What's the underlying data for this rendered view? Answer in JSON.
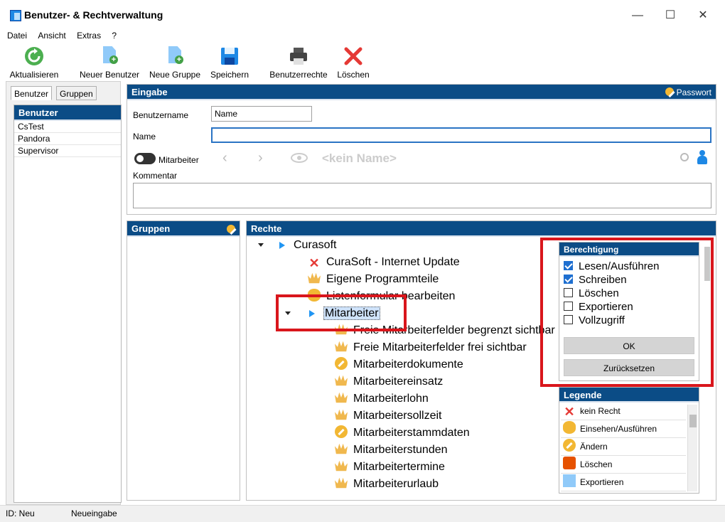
{
  "window": {
    "title": "Benutzer- &  Rechtverwaltung",
    "minimize": "—",
    "maximize": "☐",
    "close": "✕"
  },
  "menu": [
    "Datei",
    "Ansicht",
    "Extras",
    "?"
  ],
  "toolbar": {
    "refresh": "Aktualisieren",
    "new_user": "Neuer Benutzer",
    "new_group": "Neue Gruppe",
    "save": "Speichern",
    "user_rights": "Benutzerrechte",
    "delete": "Löschen"
  },
  "left": {
    "tabs": [
      "Benutzer",
      "Gruppen"
    ],
    "header": "Benutzer",
    "users": [
      "CsTest",
      "Pandora",
      "Supervisor"
    ]
  },
  "eingabe": {
    "header": "Eingabe",
    "password": "Passwort",
    "username_label": "Benutzername",
    "username_value": "Name",
    "name_label": "Name",
    "name_value": "",
    "employee_toggle": "Mitarbeiter",
    "no_name": "<kein Name>",
    "comment_label": "Kommentar"
  },
  "gruppen": {
    "header": "Gruppen"
  },
  "rechte": {
    "header": "Rechte",
    "tree": [
      {
        "label": "Curasoft",
        "icon": "expand-triangle-icon"
      },
      {
        "label": "CuraSoft - Internet Update",
        "icon": "no-right-icon"
      },
      {
        "label": "Eigene Programmteile",
        "icon": "crown-icon"
      },
      {
        "label": "Listenformular bearbeiten",
        "icon": "view-icon"
      },
      {
        "label": "Mitarbeiter",
        "icon": "expand-triangle-icon"
      },
      {
        "label": "Freie Mitarbeiterfelder begrenzt sichtbar",
        "icon": "crown-icon"
      },
      {
        "label": "Freie Mitarbeiterfelder frei sichtbar",
        "icon": "crown-icon"
      },
      {
        "label": "Mitarbeiterdokumente",
        "icon": "edit-icon"
      },
      {
        "label": "Mitarbeitereinsatz",
        "icon": "crown-icon"
      },
      {
        "label": "Mitarbeiterlohn",
        "icon": "crown-icon"
      },
      {
        "label": "Mitarbeitersollzeit",
        "icon": "crown-icon"
      },
      {
        "label": "Mitarbeiterstammdaten",
        "icon": "edit-icon"
      },
      {
        "label": "Mitarbeiterstunden",
        "icon": "crown-icon"
      },
      {
        "label": "Mitarbeitertermine",
        "icon": "crown-icon"
      },
      {
        "label": "Mitarbeiterurlaub",
        "icon": "crown-icon"
      }
    ]
  },
  "berechtigung": {
    "header": "Berechtigung",
    "options": [
      {
        "label": "Lesen/Ausführen",
        "checked": true
      },
      {
        "label": "Schreiben",
        "checked": true
      },
      {
        "label": "Löschen",
        "checked": false
      },
      {
        "label": "Exportieren",
        "checked": false
      },
      {
        "label": "Vollzugriff",
        "checked": false
      }
    ],
    "ok": "OK",
    "reset": "Zurücksetzen"
  },
  "legende": {
    "header": "Legende",
    "items": [
      "kein Recht",
      "Einsehen/Ausführen",
      "Ändern",
      "Löschen",
      "Exportieren"
    ]
  },
  "status": {
    "id": "ID: Neu",
    "mode": "Neueingabe"
  },
  "colors": {
    "header_bg": "#0b4c86",
    "highlight": "#d9161c",
    "accent": "#1e6fd0"
  }
}
